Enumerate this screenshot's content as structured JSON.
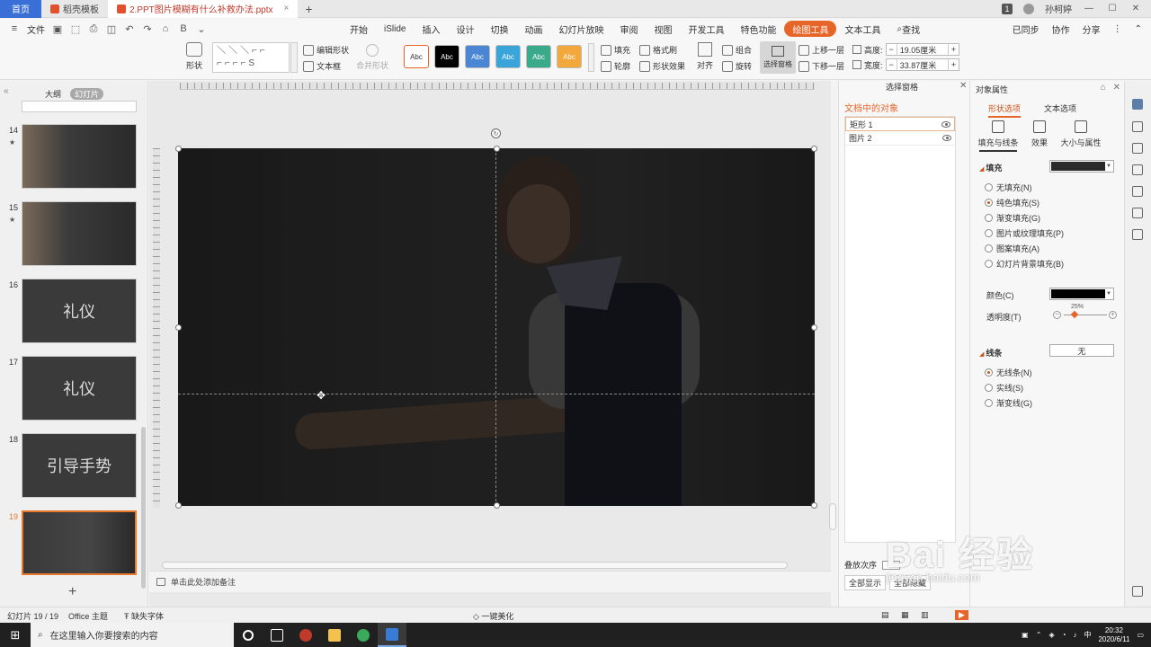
{
  "titlebar": {
    "home": "首页",
    "tab1": "稻壳模板",
    "tab2": "2.PPT图片模糊有什么补救办法.pptx",
    "badge": "1",
    "user": "孙柯婷"
  },
  "menubar": {
    "file": "文件",
    "items": [
      "开始",
      "iSlide",
      "插入",
      "设计",
      "切换",
      "动画",
      "幻灯片放映",
      "审阅",
      "视图",
      "开发工具",
      "特色功能",
      "绘图工具",
      "文本工具"
    ],
    "active_item": "绘图工具",
    "search": "查找",
    "sync": "已同步",
    "collab": "协作",
    "share": "分享"
  },
  "ribbon": {
    "shape": "形状",
    "edit_shape": "编辑形状",
    "textbox": "文本框",
    "merge_shape": "合并形状",
    "style_label": "Abc",
    "styles": [
      {
        "bg": "#ffffff",
        "fg": "#333333",
        "border": "#e8652a"
      },
      {
        "bg": "#000000",
        "fg": "#ffffff"
      },
      {
        "bg": "#4a86d4",
        "fg": "#ffffff"
      },
      {
        "bg": "#3aa5d8",
        "fg": "#ffffff"
      },
      {
        "bg": "#3aaa8a",
        "fg": "#ffffff"
      },
      {
        "bg": "#f2a83a",
        "fg": "#ffffff"
      }
    ],
    "fill": "填充",
    "format_painter": "格式刷",
    "outline": "轮廓",
    "shape_effect": "形状效果",
    "align": "对齐",
    "group": "组合",
    "rotate": "旋转",
    "selection_pane": "选择窗格",
    "bring_forward": "上移一层",
    "send_backward": "下移一层",
    "height_label": "高度:",
    "height_value": "19.05厘米",
    "width_label": "宽度:",
    "width_value": "33.87厘米"
  },
  "leftpanel": {
    "tab_outline": "大纲",
    "tab_slides": "幻灯片",
    "slides": [
      {
        "num": "14",
        "star": "★",
        "big": "",
        "sub": ""
      },
      {
        "num": "15",
        "star": "★",
        "big": "",
        "sub": ""
      },
      {
        "num": "16",
        "star": "",
        "big": "礼仪",
        "sub": ""
      },
      {
        "num": "17",
        "star": "",
        "big": "礼仪",
        "sub": ""
      },
      {
        "num": "18",
        "star": "",
        "big": "引导手势",
        "sub": ""
      },
      {
        "num": "19",
        "star": "",
        "big": "",
        "sub": ""
      }
    ]
  },
  "notes": {
    "placeholder": "单击此处添加备注"
  },
  "selpane": {
    "title": "选择窗格",
    "header": "文档中的对象",
    "objects": [
      "矩形 1",
      "图片 2"
    ],
    "reorder": "叠放次序",
    "show_all": "全部显示",
    "hide_all": "全部隐藏"
  },
  "props": {
    "title": "对象属性",
    "tab_shape": "形状选项",
    "tab_text": "文本选项",
    "sub_fill": "填充与线条",
    "sub_effect": "效果",
    "sub_size": "大小与属性",
    "fill_section": "填充",
    "fill_options": [
      "无填充(N)",
      "纯色填充(S)",
      "渐变填充(G)",
      "图片或纹理填充(P)",
      "图案填充(A)",
      "幻灯片背景填充(B)"
    ],
    "fill_selected_index": 1,
    "color_label": "颜色(C)",
    "transparency_label": "透明度(T)",
    "transparency_value": "25%",
    "fill_color": "#2a2a2a",
    "color_value": "#000000",
    "line_section": "线条",
    "line_value": "无",
    "line_options": [
      "无线条(N)",
      "实线(S)",
      "渐变线(G)"
    ],
    "line_selected_index": 0
  },
  "statusbar": {
    "slide_info": "幻灯片 19 / 19",
    "theme": "Office 主题",
    "missing_font": "缺失字体",
    "beautify": "一键美化"
  },
  "watermark": {
    "brand": "Bai 经验",
    "url": "jingyan.baidu.com"
  },
  "taskbar": {
    "search": "在这里输入你要搜索的内容",
    "time": "20:32",
    "date": "2020/6/11"
  }
}
